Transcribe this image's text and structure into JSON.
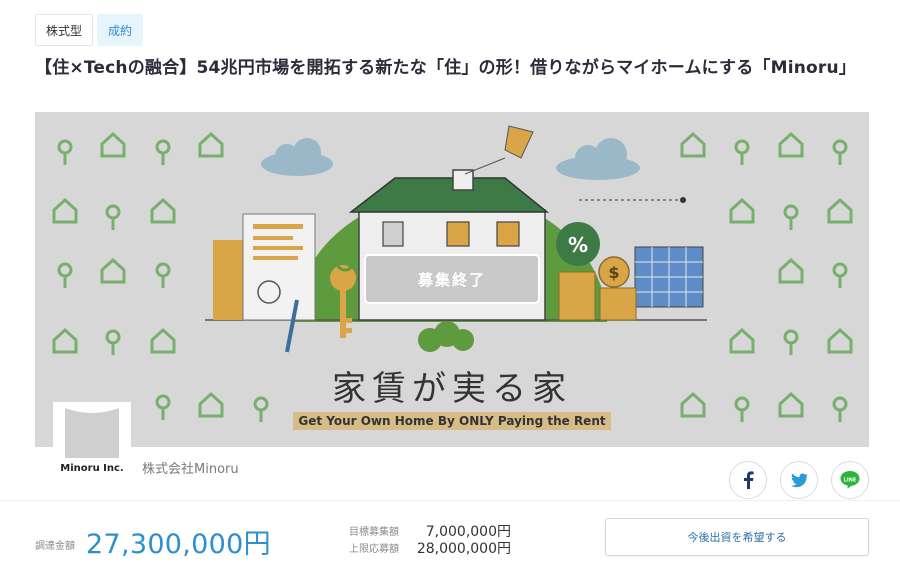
{
  "tags": {
    "type": "株式型",
    "status": "成約"
  },
  "title": "【住×Techの融合】54兆円市場を開拓する新たな「住」の形！借りながらマイホームにする「Minoru」",
  "hero": {
    "closed_label": "募集終了",
    "headline_jp": "家賃が実る家",
    "headline_en": "Get Your Own Home By ONLY Paying the Rent",
    "percent_sign": "%",
    "dollar_sign": "$"
  },
  "company": {
    "logo_text": "Minoru Inc.",
    "name": "株式会社Minoru"
  },
  "share": [
    {
      "icon": "facebook-icon",
      "color": "#1e3a6e"
    },
    {
      "icon": "twitter-icon",
      "color": "#2b9bd6"
    },
    {
      "icon": "line-icon",
      "color": "#2cb53a",
      "label": "LINE"
    }
  ],
  "funding": {
    "raised_label": "調達金額",
    "raised_amount": "27,300,000円",
    "goal_label": "目標募集額",
    "goal_amount": "7,000,000円",
    "max_label": "上限応募額",
    "max_amount": "28,000,000円"
  },
  "cta_label": "今後出資を希望する",
  "colors": {
    "accent": "#2e8fd0",
    "pattern_green": "#5fa85a",
    "house_green": "#3d7a46",
    "tag_blue": "#e6f4fb"
  }
}
